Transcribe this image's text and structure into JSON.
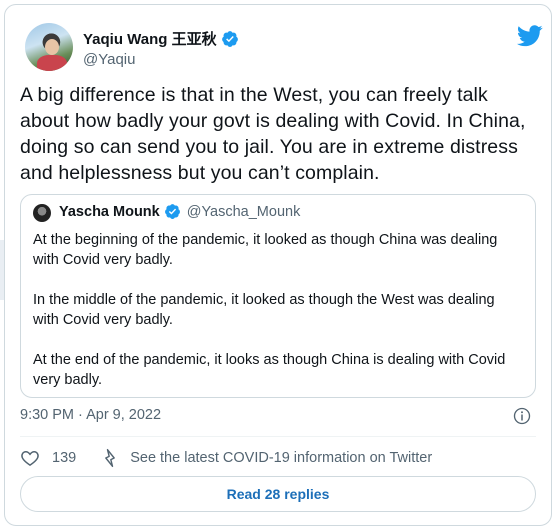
{
  "author": {
    "display_name": "Yaqiu Wang 王亚秋",
    "handle": "@Yaqiu"
  },
  "tweet": {
    "text": "A big difference is that in the West, you can freely talk about how badly your govt is dealing with Covid. In China, doing so can send you to jail. You are in extreme distress and helplessness but you can’t complain.",
    "timestamp": "9:30 PM · Apr 9, 2022"
  },
  "quoted": {
    "display_name": "Yascha Mounk",
    "handle": "@Yascha_Mounk",
    "paragraphs": [
      "At the beginning of the pandemic, it looked as though China was dealing with Covid very badly.",
      "In the middle of the pandemic, it looked as though the West was dealing with Covid very badly.",
      "At the end of the pandemic, it looks as though China is dealing with Covid very badly."
    ]
  },
  "actions": {
    "like_count": "139",
    "covid_info": "See the latest COVID-19 information on Twitter",
    "replies_label": "Read 28 replies"
  },
  "icons": [
    "verified-icon",
    "twitter-logo-icon",
    "info-icon",
    "heart-icon",
    "bolt-icon"
  ],
  "colors": {
    "accent": "#1d9bf0",
    "link": "#1d6fb8",
    "secondary_text": "#536471",
    "border": "#cfd9de"
  }
}
